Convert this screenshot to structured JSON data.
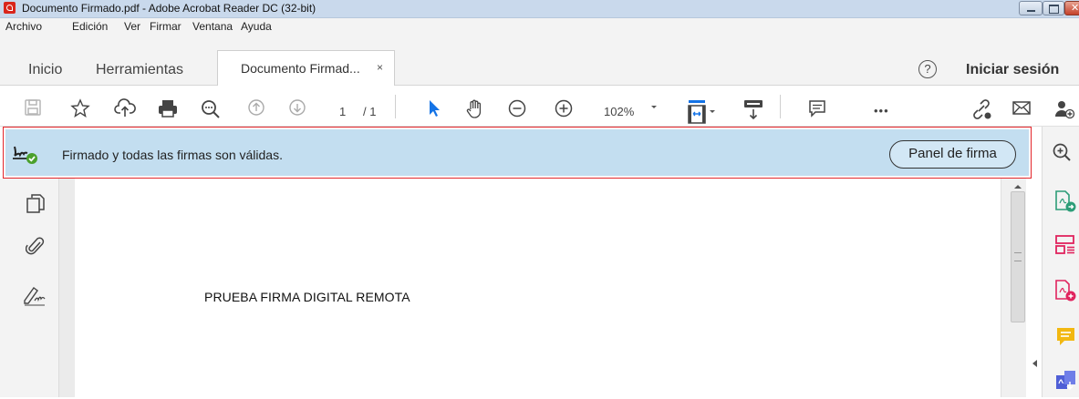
{
  "window": {
    "title": "Documento Firmado.pdf - Adobe Acrobat Reader DC (32-bit)"
  },
  "menu": [
    "Archivo",
    "Edición",
    "Ver",
    "Firmar",
    "Ventana",
    "Ayuda"
  ],
  "tabs": {
    "home": "Inicio",
    "tools": "Herramientas",
    "document": "Documento Firmad...",
    "close_glyph": "×"
  },
  "account": {
    "help_glyph": "?",
    "signin": "Iniciar sesión"
  },
  "toolbar": {
    "page_current": "1",
    "page_total": "/ 1",
    "zoom": "102%",
    "more": "•••"
  },
  "signature_bar": {
    "message": "Firmado y todas las firmas son válidas.",
    "panel_button": "Panel de firma",
    "status_color": "#4aa02c"
  },
  "document": {
    "text": "PRUEBA FIRMA DIGITAL REMOTA"
  },
  "colors": {
    "banner_bg": "#c3def0",
    "highlight_border": "#e3262b",
    "selection_blue": "#1473e6",
    "pdf_red": "#e0245e",
    "note_yellow": "#f2b811",
    "export_green": "#2d9d78"
  }
}
